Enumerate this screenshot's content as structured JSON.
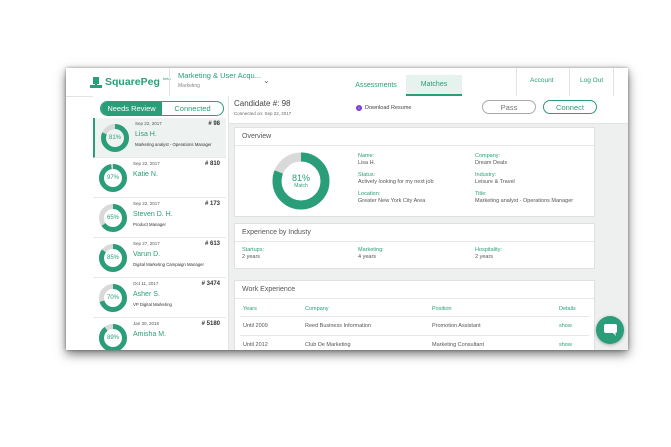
{
  "app": {
    "name": "SquarePeg",
    "badge": "beta"
  },
  "job": {
    "title": "Marketing & User Acqu...",
    "subtitle": "Marketing"
  },
  "nav": {
    "tabs": [
      {
        "label": "Assessments"
      },
      {
        "label": "Matches",
        "active": true
      }
    ],
    "account": "Account",
    "logout": "Log Out"
  },
  "sidebar": {
    "toggle": {
      "review": "Needs Review",
      "connected": "Connected"
    },
    "candidates": [
      {
        "date": "Sep 22, 2017",
        "num": "# 98",
        "name": "Lisa H.",
        "role": "Marketing analyst - Operations Manager",
        "match": "81%",
        "match_value": 0.81
      },
      {
        "date": "Sep 22, 2017",
        "num": "# 810",
        "name": "Katie N.",
        "role": "",
        "match": "97%",
        "match_value": 0.97
      },
      {
        "date": "Sep 22, 2017",
        "num": "# 173",
        "name": "Steven D. H.",
        "role": "Product Manager",
        "match": "65%",
        "match_value": 0.65
      },
      {
        "date": "Sep 27, 2017",
        "num": "# 613",
        "name": "Varun D.",
        "role": "Digital Marketing Campaign Manager",
        "match": "85%",
        "match_value": 0.85
      },
      {
        "date": "Oct 11, 2017",
        "num": "# 3474",
        "name": "Asher S.",
        "role": "VP Digital Marketing",
        "match": "70%",
        "match_value": 0.7
      },
      {
        "date": "Jan 30, 2018",
        "num": "# 5180",
        "name": "Amisha M.",
        "role": "",
        "match": "89%",
        "match_value": 0.89
      }
    ]
  },
  "candidate": {
    "title": "Candidate #: 98",
    "connected_on": "Connected on: Sep 22, 2017",
    "download": "Download Resume",
    "pass": "Pass",
    "connect": "Connect"
  },
  "overview": {
    "heading": "Overview",
    "match_pct": "81%",
    "match_value": 0.81,
    "match_label": "Match",
    "fields": {
      "name_label": "Name:",
      "name": "Lisa H.",
      "status_label": "Status:",
      "status": "Actively looking for my next job",
      "location_label": "Location:",
      "location": "Greater New York City Area",
      "company_label": "Company:",
      "company": "Dream Deals",
      "industry_label": "Industry:",
      "industry": "Leisure & Travel",
      "title_label": "Title:",
      "title": "Marketing analyst - Operations Manager"
    }
  },
  "industry_exp": {
    "heading": "Experience by Industy",
    "items": [
      {
        "label": "Startups:",
        "value": "2 years"
      },
      {
        "label": "Marketing:",
        "value": "4 years"
      },
      {
        "label": "Hospitality:",
        "value": "2 years"
      }
    ]
  },
  "work": {
    "heading": "Work Experience",
    "headers": {
      "years": "Years",
      "company": "Company",
      "position": "Position",
      "details": "Details"
    },
    "rows": [
      {
        "years": "Until 2009",
        "company": "Reed Business Information",
        "position": "Promotion Assistant",
        "details": "show"
      },
      {
        "years": "Until 2012",
        "company": "Club De Marketing",
        "position": "Marketing Consultant",
        "details": "show"
      }
    ]
  },
  "colors": {
    "accent": "#2a9d79",
    "ring_bg": "#d9d9d9"
  }
}
